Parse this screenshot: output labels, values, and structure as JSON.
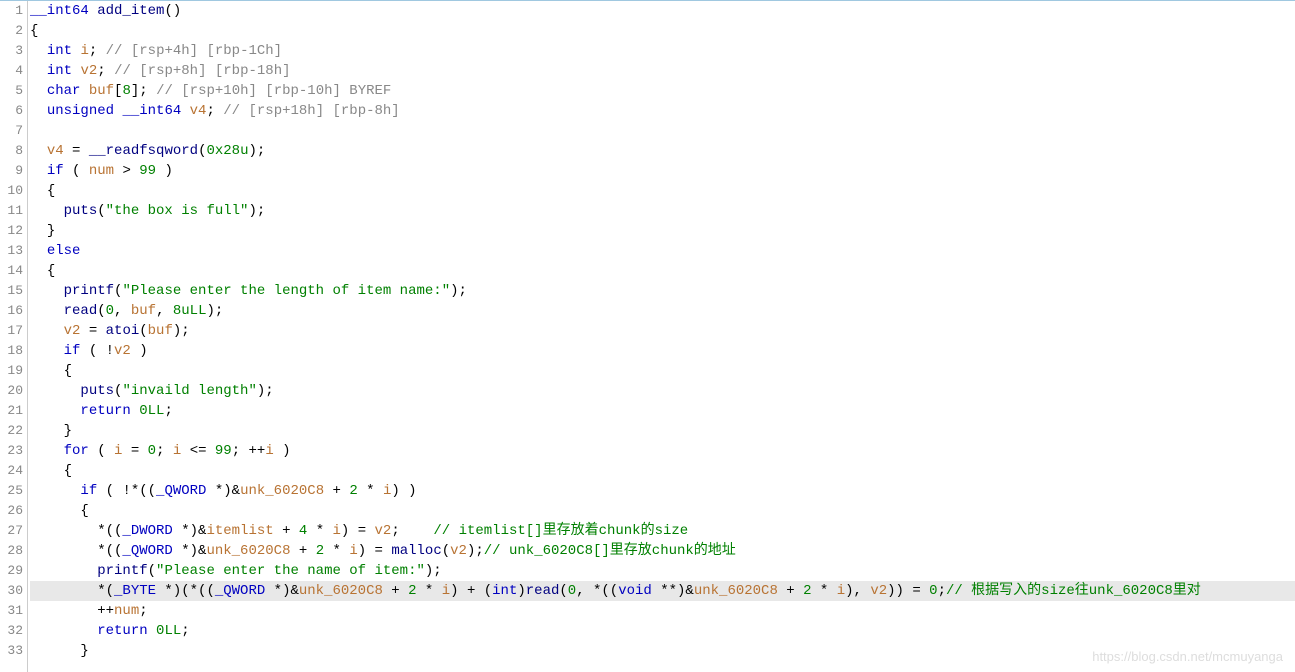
{
  "watermark": "https://blog.csdn.net/mcmuyanga",
  "line_count": 33,
  "highlighted_line": 30,
  "tokens": {
    "l1": [
      {
        "t": "type",
        "v": "__int64"
      },
      {
        "t": "plain",
        "v": " "
      },
      {
        "t": "fn",
        "v": "add_item"
      },
      {
        "t": "punct",
        "v": "()"
      }
    ],
    "l2": [
      {
        "t": "punct",
        "v": "{"
      }
    ],
    "l3": [
      {
        "t": "plain",
        "v": "  "
      },
      {
        "t": "kw",
        "v": "int"
      },
      {
        "t": "plain",
        "v": " "
      },
      {
        "t": "var",
        "v": "i"
      },
      {
        "t": "punct",
        "v": "; "
      },
      {
        "t": "cmt",
        "v": "// [rsp+4h] [rbp-1Ch]"
      }
    ],
    "l4": [
      {
        "t": "plain",
        "v": "  "
      },
      {
        "t": "kw",
        "v": "int"
      },
      {
        "t": "plain",
        "v": " "
      },
      {
        "t": "var",
        "v": "v2"
      },
      {
        "t": "punct",
        "v": "; "
      },
      {
        "t": "cmt",
        "v": "// [rsp+8h] [rbp-18h]"
      }
    ],
    "l5": [
      {
        "t": "plain",
        "v": "  "
      },
      {
        "t": "kw",
        "v": "char"
      },
      {
        "t": "plain",
        "v": " "
      },
      {
        "t": "var",
        "v": "buf"
      },
      {
        "t": "punct",
        "v": "["
      },
      {
        "t": "num",
        "v": "8"
      },
      {
        "t": "punct",
        "v": "]; "
      },
      {
        "t": "cmt",
        "v": "// [rsp+10h] [rbp-10h] BYREF"
      }
    ],
    "l6": [
      {
        "t": "plain",
        "v": "  "
      },
      {
        "t": "kw",
        "v": "unsigned"
      },
      {
        "t": "plain",
        "v": " "
      },
      {
        "t": "type",
        "v": "__int64"
      },
      {
        "t": "plain",
        "v": " "
      },
      {
        "t": "var",
        "v": "v4"
      },
      {
        "t": "punct",
        "v": "; "
      },
      {
        "t": "cmt",
        "v": "// [rsp+18h] [rbp-8h]"
      }
    ],
    "l7": [],
    "l8": [
      {
        "t": "plain",
        "v": "  "
      },
      {
        "t": "var",
        "v": "v4"
      },
      {
        "t": "punct",
        "v": " = "
      },
      {
        "t": "fn",
        "v": "__readfsqword"
      },
      {
        "t": "punct",
        "v": "("
      },
      {
        "t": "hex",
        "v": "0x28u"
      },
      {
        "t": "punct",
        "v": ");"
      }
    ],
    "l9": [
      {
        "t": "plain",
        "v": "  "
      },
      {
        "t": "kw",
        "v": "if"
      },
      {
        "t": "punct",
        "v": " ( "
      },
      {
        "t": "var",
        "v": "num"
      },
      {
        "t": "punct",
        "v": " > "
      },
      {
        "t": "num",
        "v": "99"
      },
      {
        "t": "punct",
        "v": " )"
      }
    ],
    "l10": [
      {
        "t": "plain",
        "v": "  "
      },
      {
        "t": "punct",
        "v": "{"
      }
    ],
    "l11": [
      {
        "t": "plain",
        "v": "    "
      },
      {
        "t": "fn",
        "v": "puts"
      },
      {
        "t": "punct",
        "v": "("
      },
      {
        "t": "str",
        "v": "\"the box is full\""
      },
      {
        "t": "punct",
        "v": ");"
      }
    ],
    "l12": [
      {
        "t": "plain",
        "v": "  "
      },
      {
        "t": "punct",
        "v": "}"
      }
    ],
    "l13": [
      {
        "t": "plain",
        "v": "  "
      },
      {
        "t": "kw",
        "v": "else"
      }
    ],
    "l14": [
      {
        "t": "plain",
        "v": "  "
      },
      {
        "t": "punct",
        "v": "{"
      }
    ],
    "l15": [
      {
        "t": "plain",
        "v": "    "
      },
      {
        "t": "fn",
        "v": "printf"
      },
      {
        "t": "punct",
        "v": "("
      },
      {
        "t": "str",
        "v": "\"Please enter the length of item name:\""
      },
      {
        "t": "punct",
        "v": ");"
      }
    ],
    "l16": [
      {
        "t": "plain",
        "v": "    "
      },
      {
        "t": "fn",
        "v": "read"
      },
      {
        "t": "punct",
        "v": "("
      },
      {
        "t": "num",
        "v": "0"
      },
      {
        "t": "punct",
        "v": ", "
      },
      {
        "t": "var",
        "v": "buf"
      },
      {
        "t": "punct",
        "v": ", "
      },
      {
        "t": "num",
        "v": "8uLL"
      },
      {
        "t": "punct",
        "v": ");"
      }
    ],
    "l17": [
      {
        "t": "plain",
        "v": "    "
      },
      {
        "t": "var",
        "v": "v2"
      },
      {
        "t": "punct",
        "v": " = "
      },
      {
        "t": "fn",
        "v": "atoi"
      },
      {
        "t": "punct",
        "v": "("
      },
      {
        "t": "var",
        "v": "buf"
      },
      {
        "t": "punct",
        "v": ");"
      }
    ],
    "l18": [
      {
        "t": "plain",
        "v": "    "
      },
      {
        "t": "kw",
        "v": "if"
      },
      {
        "t": "punct",
        "v": " ( !"
      },
      {
        "t": "var",
        "v": "v2"
      },
      {
        "t": "punct",
        "v": " )"
      }
    ],
    "l19": [
      {
        "t": "plain",
        "v": "    "
      },
      {
        "t": "punct",
        "v": "{"
      }
    ],
    "l20": [
      {
        "t": "plain",
        "v": "      "
      },
      {
        "t": "fn",
        "v": "puts"
      },
      {
        "t": "punct",
        "v": "("
      },
      {
        "t": "str",
        "v": "\"invaild length\""
      },
      {
        "t": "punct",
        "v": ");"
      }
    ],
    "l21": [
      {
        "t": "plain",
        "v": "      "
      },
      {
        "t": "kw",
        "v": "return"
      },
      {
        "t": "plain",
        "v": " "
      },
      {
        "t": "num",
        "v": "0LL"
      },
      {
        "t": "punct",
        "v": ";"
      }
    ],
    "l22": [
      {
        "t": "plain",
        "v": "    "
      },
      {
        "t": "punct",
        "v": "}"
      }
    ],
    "l23": [
      {
        "t": "plain",
        "v": "    "
      },
      {
        "t": "kw",
        "v": "for"
      },
      {
        "t": "punct",
        "v": " ( "
      },
      {
        "t": "var",
        "v": "i"
      },
      {
        "t": "punct",
        "v": " = "
      },
      {
        "t": "num",
        "v": "0"
      },
      {
        "t": "punct",
        "v": "; "
      },
      {
        "t": "var",
        "v": "i"
      },
      {
        "t": "punct",
        "v": " <= "
      },
      {
        "t": "num",
        "v": "99"
      },
      {
        "t": "punct",
        "v": "; ++"
      },
      {
        "t": "var",
        "v": "i"
      },
      {
        "t": "punct",
        "v": " )"
      }
    ],
    "l24": [
      {
        "t": "plain",
        "v": "    "
      },
      {
        "t": "punct",
        "v": "{"
      }
    ],
    "l25": [
      {
        "t": "plain",
        "v": "      "
      },
      {
        "t": "kw",
        "v": "if"
      },
      {
        "t": "punct",
        "v": " ( !*(("
      },
      {
        "t": "type",
        "v": "_QWORD"
      },
      {
        "t": "punct",
        "v": " *)&"
      },
      {
        "t": "var",
        "v": "unk_6020C8"
      },
      {
        "t": "punct",
        "v": " + "
      },
      {
        "t": "num",
        "v": "2"
      },
      {
        "t": "punct",
        "v": " * "
      },
      {
        "t": "var",
        "v": "i"
      },
      {
        "t": "punct",
        "v": ") )"
      }
    ],
    "l26": [
      {
        "t": "plain",
        "v": "      "
      },
      {
        "t": "punct",
        "v": "{"
      }
    ],
    "l27": [
      {
        "t": "plain",
        "v": "        *(("
      },
      {
        "t": "type",
        "v": "_DWORD"
      },
      {
        "t": "punct",
        "v": " *)&"
      },
      {
        "t": "var",
        "v": "itemlist"
      },
      {
        "t": "punct",
        "v": " + "
      },
      {
        "t": "num",
        "v": "4"
      },
      {
        "t": "punct",
        "v": " * "
      },
      {
        "t": "var",
        "v": "i"
      },
      {
        "t": "punct",
        "v": ") = "
      },
      {
        "t": "var",
        "v": "v2"
      },
      {
        "t": "punct",
        "v": ";    "
      },
      {
        "t": "green",
        "v": "// itemlist[]里存放着chunk的size"
      }
    ],
    "l28": [
      {
        "t": "plain",
        "v": "        *(("
      },
      {
        "t": "type",
        "v": "_QWORD"
      },
      {
        "t": "punct",
        "v": " *)&"
      },
      {
        "t": "var",
        "v": "unk_6020C8"
      },
      {
        "t": "punct",
        "v": " + "
      },
      {
        "t": "num",
        "v": "2"
      },
      {
        "t": "punct",
        "v": " * "
      },
      {
        "t": "var",
        "v": "i"
      },
      {
        "t": "punct",
        "v": ") = "
      },
      {
        "t": "fn",
        "v": "malloc"
      },
      {
        "t": "punct",
        "v": "("
      },
      {
        "t": "var",
        "v": "v2"
      },
      {
        "t": "punct",
        "v": ");"
      },
      {
        "t": "green",
        "v": "// unk_6020C8[]里存放chunk的地址"
      }
    ],
    "l29": [
      {
        "t": "plain",
        "v": "        "
      },
      {
        "t": "fn",
        "v": "printf"
      },
      {
        "t": "punct",
        "v": "("
      },
      {
        "t": "str",
        "v": "\"Please enter the name of item:\""
      },
      {
        "t": "punct",
        "v": ");"
      }
    ],
    "l30": [
      {
        "t": "plain",
        "v": "        *("
      },
      {
        "t": "type",
        "v": "_BYTE"
      },
      {
        "t": "punct",
        "v": " *)(*(("
      },
      {
        "t": "type",
        "v": "_QWORD"
      },
      {
        "t": "punct",
        "v": " *)&"
      },
      {
        "t": "var",
        "v": "unk_6020C8"
      },
      {
        "t": "punct",
        "v": " + "
      },
      {
        "t": "num",
        "v": "2"
      },
      {
        "t": "punct",
        "v": " * "
      },
      {
        "t": "var",
        "v": "i"
      },
      {
        "t": "punct",
        "v": ") + ("
      },
      {
        "t": "kw",
        "v": "int"
      },
      {
        "t": "punct",
        "v": ")"
      },
      {
        "t": "fn",
        "v": "read"
      },
      {
        "t": "punct",
        "v": "("
      },
      {
        "t": "num",
        "v": "0"
      },
      {
        "t": "punct",
        "v": ", *(("
      },
      {
        "t": "kw",
        "v": "void"
      },
      {
        "t": "punct",
        "v": " **)&"
      },
      {
        "t": "var",
        "v": "unk_6020C8"
      },
      {
        "t": "punct",
        "v": " + "
      },
      {
        "t": "num",
        "v": "2"
      },
      {
        "t": "punct",
        "v": " * "
      },
      {
        "t": "var",
        "v": "i"
      },
      {
        "t": "punct",
        "v": "), "
      },
      {
        "t": "var",
        "v": "v2"
      },
      {
        "t": "punct",
        "v": ")) = "
      },
      {
        "t": "num",
        "v": "0"
      },
      {
        "t": "punct",
        "v": ";"
      },
      {
        "t": "green",
        "v": "// 根据写入的size往unk_6020C8里对"
      }
    ],
    "l31": [
      {
        "t": "plain",
        "v": "        ++"
      },
      {
        "t": "var",
        "v": "num"
      },
      {
        "t": "punct",
        "v": ";"
      }
    ],
    "l32": [
      {
        "t": "plain",
        "v": "        "
      },
      {
        "t": "kw",
        "v": "return"
      },
      {
        "t": "plain",
        "v": " "
      },
      {
        "t": "num",
        "v": "0LL"
      },
      {
        "t": "punct",
        "v": ";"
      }
    ],
    "l33": [
      {
        "t": "plain",
        "v": "      "
      },
      {
        "t": "punct",
        "v": "}"
      }
    ]
  }
}
